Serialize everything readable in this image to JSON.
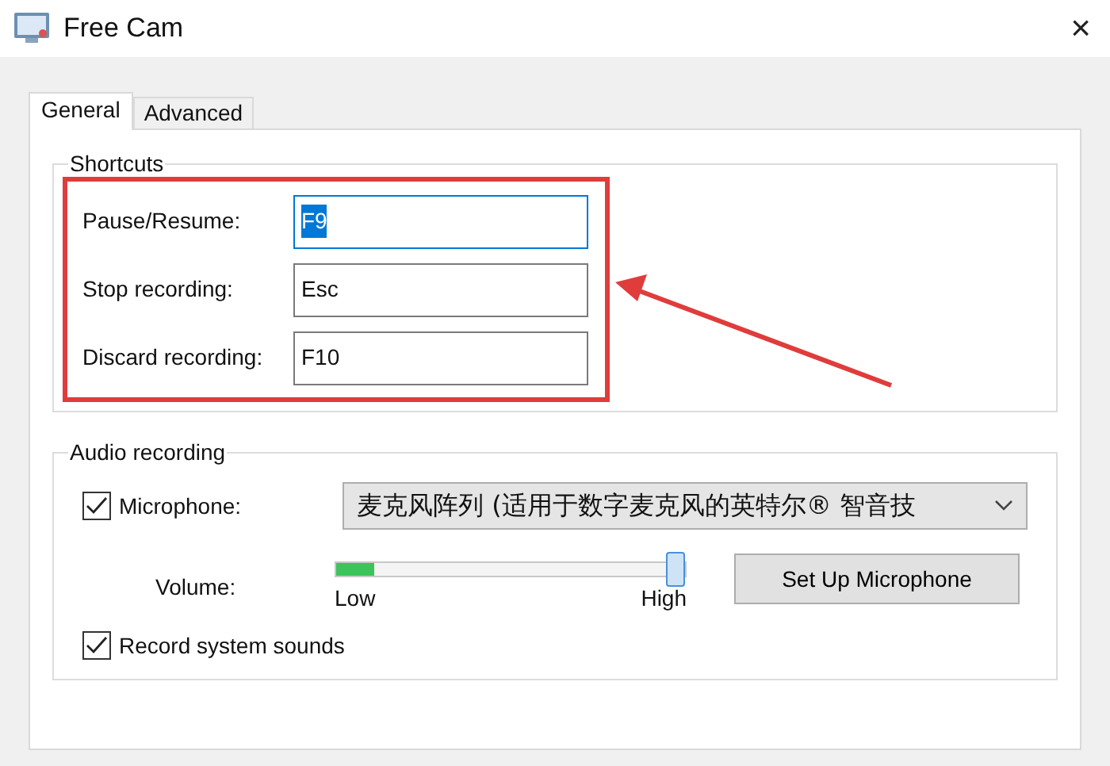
{
  "window": {
    "title": "Free Cam",
    "close": "×"
  },
  "tabs": [
    {
      "label": "General",
      "selected": true
    },
    {
      "label": "Advanced",
      "selected": false
    }
  ],
  "shortcuts": {
    "title": "Shortcuts",
    "rows": [
      {
        "label": "Pause/Resume:",
        "value": "F9",
        "focused": true
      },
      {
        "label": "Stop recording:",
        "value": "Esc",
        "focused": false
      },
      {
        "label": "Discard recording:",
        "value": "F10",
        "focused": false
      }
    ]
  },
  "annotation": {
    "kind": "highlight-arrow"
  },
  "audio": {
    "title": "Audio recording",
    "microphone": {
      "label": "Microphone:",
      "checked": true,
      "device": "麦克风阵列 (适用于数字麦克风的英特尔® 智音技"
    },
    "volume": {
      "label": "Volume:",
      "input_meter": {
        "level": 0.11
      },
      "slider": {
        "level": 1.0
      },
      "low": "Low",
      "high": "High"
    },
    "setup_button": "Set Up Microphone",
    "system_sounds": {
      "label": "Record system sounds",
      "checked": true
    }
  }
}
